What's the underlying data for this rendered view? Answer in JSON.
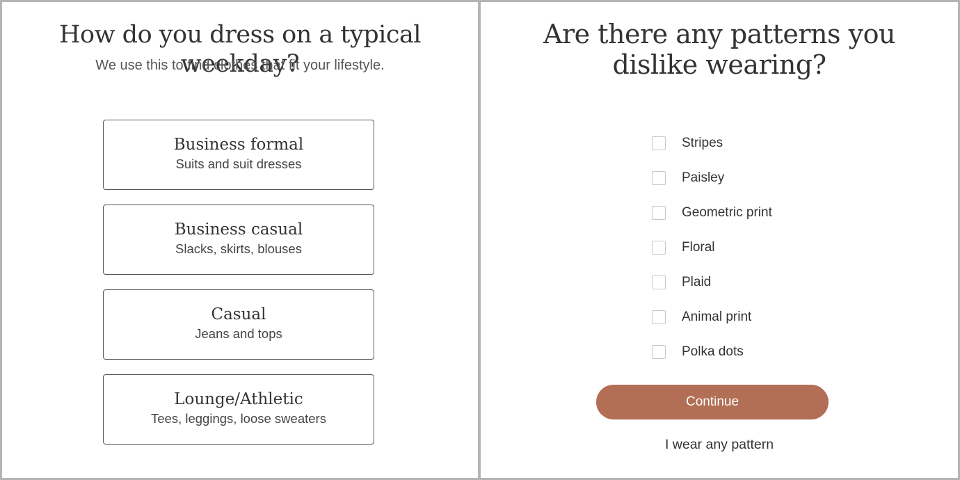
{
  "left_panel": {
    "title": "How do you dress on a typical weekday?",
    "subtitle": "We use this to find clothes that fit your lifestyle.",
    "options": [
      {
        "title": "Business formal",
        "description": "Suits and suit dresses"
      },
      {
        "title": "Business casual",
        "description": "Slacks, skirts, blouses"
      },
      {
        "title": "Casual",
        "description": "Jeans and tops"
      },
      {
        "title": "Lounge/Athletic",
        "description": "Tees, leggings, loose sweaters"
      }
    ]
  },
  "right_panel": {
    "title": "Are there any patterns you dislike wearing?",
    "patterns": [
      {
        "label": "Stripes",
        "checked": false
      },
      {
        "label": "Paisley",
        "checked": false
      },
      {
        "label": "Geometric print",
        "checked": false
      },
      {
        "label": "Floral",
        "checked": false
      },
      {
        "label": "Plaid",
        "checked": false
      },
      {
        "label": "Animal print",
        "checked": false
      },
      {
        "label": "Polka dots",
        "checked": false
      }
    ],
    "continue_label": "Continue",
    "skip_label": "I wear any pattern"
  },
  "colors": {
    "accent": "#b26f55",
    "divider": "#b4b4b4"
  }
}
